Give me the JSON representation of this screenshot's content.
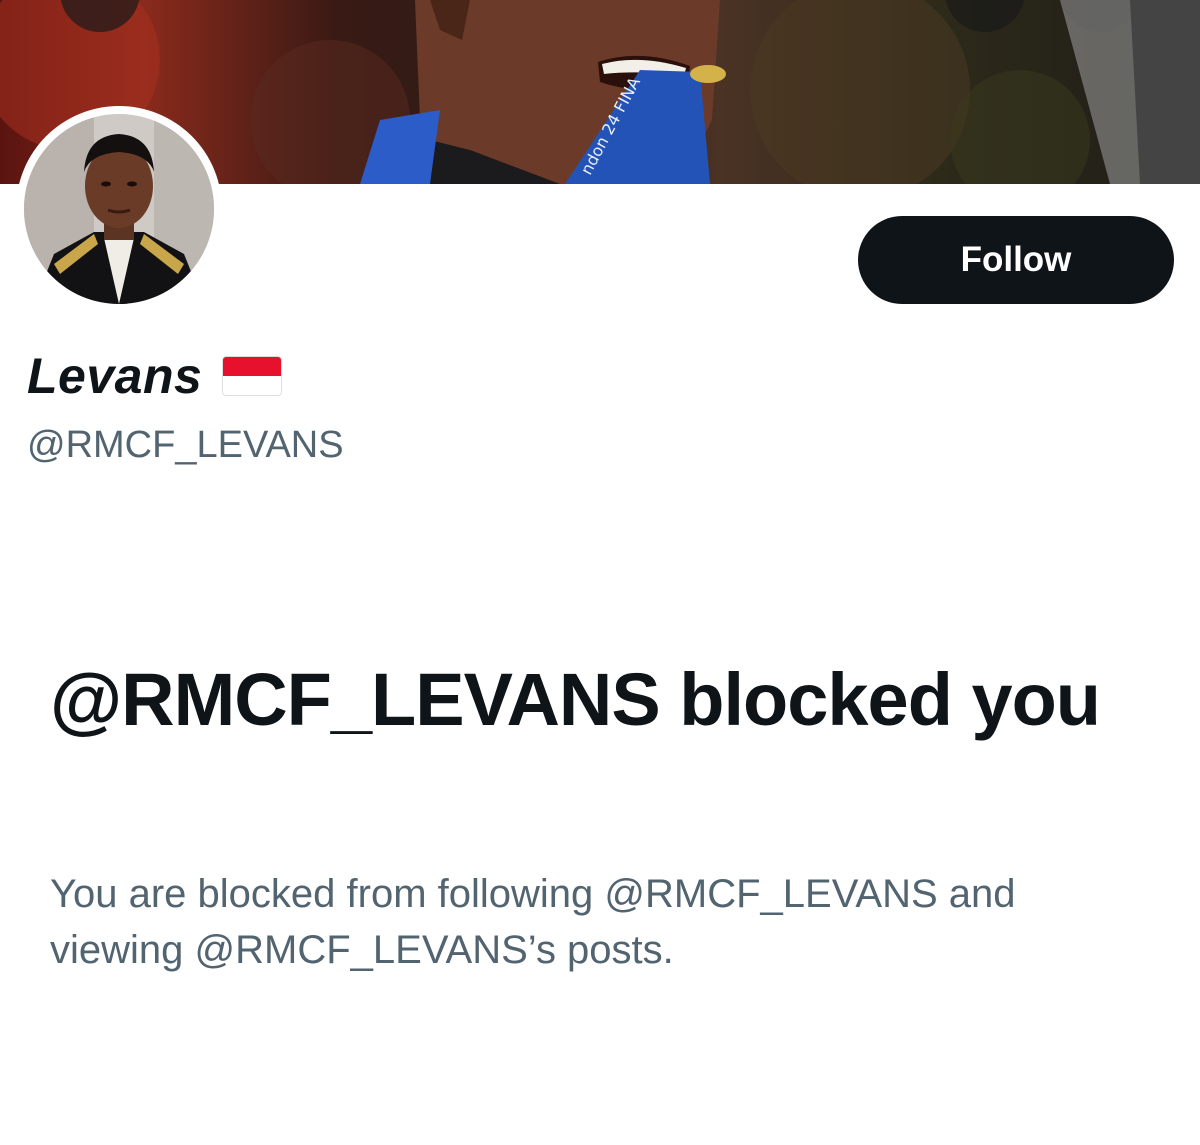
{
  "profile": {
    "display_name": "Levans",
    "flag_icon": "indonesia-flag-icon",
    "handle": "@RMCF_LEVANS",
    "follow_label": "Follow"
  },
  "blocked": {
    "title": "@RMCF_LEVANS blocked you",
    "description": "You are blocked from following @RMCF_LEVANS and viewing @RMCF_LEVANS’s posts."
  },
  "colors": {
    "primary_text": "#0f1419",
    "secondary_text": "#536471",
    "button_bg": "#0f1419",
    "button_text": "#ffffff",
    "background": "#ffffff"
  }
}
